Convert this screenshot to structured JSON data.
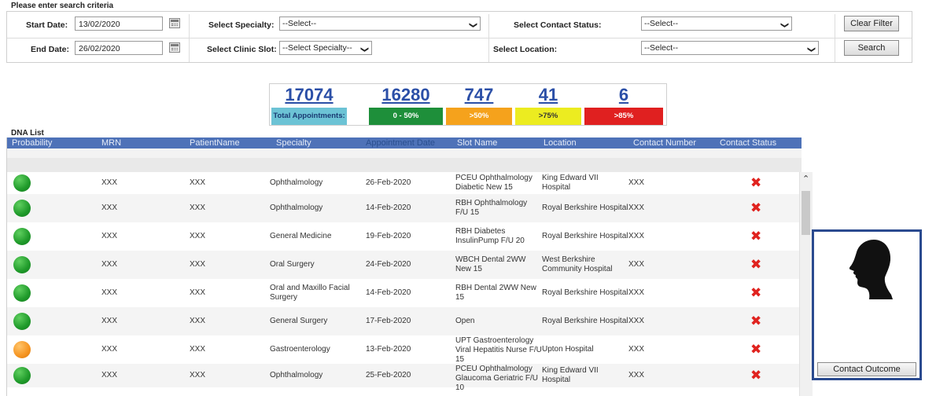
{
  "criteria": {
    "title": "Please enter search criteria",
    "start_date_label": "Start Date:",
    "start_date_value": "13/02/2020",
    "end_date_label": "End Date:",
    "end_date_value": "26/02/2020",
    "specialty_label": "Select Specialty:",
    "specialty_value": "--Select--",
    "clinic_slot_label": "Select Clinic Slot:",
    "clinic_slot_value": "--Select Specialty--",
    "contact_status_label": "Select Contact Status:",
    "contact_status_value": "--Select--",
    "location_label": "Select Location:",
    "location_value": "--Select--",
    "clear_filter_label": "Clear Filter",
    "search_label": "Search"
  },
  "stats": [
    {
      "value": "17074",
      "label": "Total Appointments:",
      "color": "#6cc3d5"
    },
    {
      "value": "16280",
      "label": "0 - 50%",
      "color": "#1e8f3a"
    },
    {
      "value": "747",
      "label": ">50%",
      "color": "#f5a21c"
    },
    {
      "value": "41",
      "label": ">75%",
      "color": "#ecec20"
    },
    {
      "value": "6",
      "label": ">85%",
      "color": "#e02020"
    }
  ],
  "list": {
    "title": "DNA List",
    "columns": [
      "Probability",
      "MRN",
      "PatientName",
      "Specialty",
      "Appointment Date",
      "Slot Name",
      "Location",
      "Contact Number",
      "Contact Status"
    ],
    "rows": [
      {
        "probability": "green",
        "mrn": "XXX",
        "patient": "XXX",
        "specialty": "Ophthalmology",
        "date": "26-Feb-2020",
        "slot": "PCEU Ophthalmology Diabetic New 15",
        "location": "King Edward VII Hospital",
        "contact": "XXX",
        "status_icon": "x-icon"
      },
      {
        "probability": "green",
        "mrn": "XXX",
        "patient": "XXX",
        "specialty": "Ophthalmology",
        "date": "14-Feb-2020",
        "slot": "RBH Ophthalmology F/U 15",
        "location": "Royal Berkshire Hospital",
        "contact": "XXX",
        "status_icon": "x-icon"
      },
      {
        "probability": "green",
        "mrn": "XXX",
        "patient": "XXX",
        "specialty": "General Medicine",
        "date": "19-Feb-2020",
        "slot": "RBH Diabetes InsulinPump F/U 20",
        "location": "Royal Berkshire Hospital",
        "contact": "XXX",
        "status_icon": "x-icon"
      },
      {
        "probability": "green",
        "mrn": "XXX",
        "patient": "XXX",
        "specialty": "Oral Surgery",
        "date": "24-Feb-2020",
        "slot": "WBCH Dental 2WW New 15",
        "location": "West Berkshire Community Hospital",
        "contact": "XXX",
        "status_icon": "x-icon"
      },
      {
        "probability": "green",
        "mrn": "XXX",
        "patient": "XXX",
        "specialty": "Oral and Maxillo Facial Surgery",
        "date": "14-Feb-2020",
        "slot": "RBH Dental 2WW New 15",
        "location": "Royal Berkshire Hospital",
        "contact": "XXX",
        "status_icon": "x-icon"
      },
      {
        "probability": "green",
        "mrn": "XXX",
        "patient": "XXX",
        "specialty": "General Surgery",
        "date": "17-Feb-2020",
        "slot": "Open",
        "location": "Royal Berkshire Hospital",
        "contact": "XXX",
        "status_icon": "x-icon"
      },
      {
        "probability": "orange",
        "mrn": "XXX",
        "patient": "XXX",
        "specialty": "Gastroenterology",
        "date": "13-Feb-2020",
        "slot": "UPT Gastroenterology Viral Hepatitis Nurse F/U 15",
        "location": "Upton Hospital",
        "contact": "XXX",
        "status_icon": "x-icon"
      },
      {
        "probability": "green",
        "mrn": "XXX",
        "patient": "XXX",
        "specialty": "Ophthalmology",
        "date": "25-Feb-2020",
        "slot": "PCEU Ophthalmology Glaucoma Geriatric F/U 10",
        "location": "King Edward VII Hospital",
        "contact": "XXX",
        "status_icon": "x-icon"
      }
    ]
  },
  "panel": {
    "icon": "person-head-icon",
    "button_label": "Contact Outcome"
  },
  "colors": {
    "header_bg": "#4e72b8",
    "link": "#2b4fa7",
    "status_x": "#e0231f",
    "panel_border": "#2a4a8f"
  }
}
